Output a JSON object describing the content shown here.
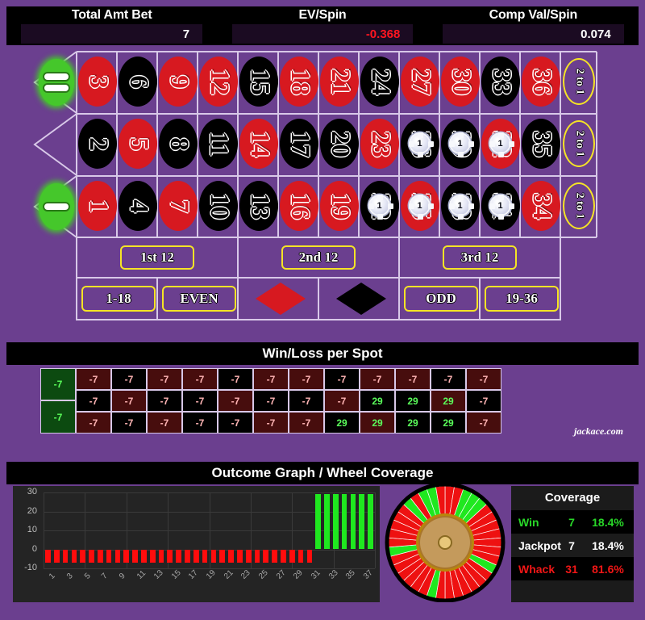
{
  "stats": {
    "items": [
      {
        "label": "Total Amt Bet",
        "value": "7",
        "negative": false
      },
      {
        "label": "EV/Spin",
        "value": "-0.368",
        "negative": true
      },
      {
        "label": "Comp Val/Spin",
        "value": "0.074",
        "negative": false
      }
    ]
  },
  "table": {
    "zeros": [
      {
        "name": "00",
        "pips": 2
      },
      {
        "name": "0",
        "pips": 1
      }
    ],
    "rows": [
      {
        "numbers": [
          {
            "n": "3",
            "color": "red"
          },
          {
            "n": "6",
            "color": "black"
          },
          {
            "n": "9",
            "color": "red"
          },
          {
            "n": "12",
            "color": "red"
          },
          {
            "n": "15",
            "color": "black"
          },
          {
            "n": "18",
            "color": "red"
          },
          {
            "n": "21",
            "color": "red"
          },
          {
            "n": "24",
            "color": "black"
          },
          {
            "n": "27",
            "color": "red"
          },
          {
            "n": "30",
            "color": "red"
          },
          {
            "n": "33",
            "color": "black"
          },
          {
            "n": "36",
            "color": "red"
          }
        ]
      },
      {
        "numbers": [
          {
            "n": "2",
            "color": "black"
          },
          {
            "n": "5",
            "color": "red"
          },
          {
            "n": "8",
            "color": "black"
          },
          {
            "n": "11",
            "color": "black"
          },
          {
            "n": "14",
            "color": "red"
          },
          {
            "n": "17",
            "color": "black"
          },
          {
            "n": "20",
            "color": "black"
          },
          {
            "n": "23",
            "color": "red"
          },
          {
            "n": "26",
            "color": "black",
            "chip": "1"
          },
          {
            "n": "29",
            "color": "black",
            "chip": "1"
          },
          {
            "n": "32",
            "color": "red",
            "chip": "1"
          },
          {
            "n": "35",
            "color": "black"
          }
        ]
      },
      {
        "numbers": [
          {
            "n": "1",
            "color": "red"
          },
          {
            "n": "4",
            "color": "black"
          },
          {
            "n": "7",
            "color": "red"
          },
          {
            "n": "10",
            "color": "black"
          },
          {
            "n": "13",
            "color": "black"
          },
          {
            "n": "16",
            "color": "red"
          },
          {
            "n": "19",
            "color": "red"
          },
          {
            "n": "22",
            "color": "black",
            "chip": "1"
          },
          {
            "n": "25",
            "color": "red",
            "chip": "1"
          },
          {
            "n": "28",
            "color": "black",
            "chip": "1"
          },
          {
            "n": "31",
            "color": "black",
            "chip": "1"
          },
          {
            "n": "34",
            "color": "red"
          }
        ]
      }
    ],
    "column_bets": [
      "2 to 1",
      "2 to 1",
      "2 to 1"
    ],
    "dozens": [
      "1st 12",
      "2nd 12",
      "3rd 12"
    ],
    "outside": [
      {
        "label": "1-18",
        "kind": "text"
      },
      {
        "label": "EVEN",
        "kind": "text"
      },
      {
        "label": "RED",
        "kind": "diamond-red"
      },
      {
        "label": "BLACK",
        "kind": "diamond-black"
      },
      {
        "label": "ODD",
        "kind": "text"
      },
      {
        "label": "19-36",
        "kind": "text"
      }
    ]
  },
  "winloss": {
    "title": "Win/Loss per Spot",
    "zero_cells": [
      {
        "label": "-7",
        "name": "00"
      },
      {
        "label": "-7",
        "name": "0"
      }
    ],
    "rows": [
      {
        "cells": [
          {
            "v": "-7",
            "color": "red",
            "res": "lose"
          },
          {
            "v": "-7",
            "color": "black",
            "res": "lose"
          },
          {
            "v": "-7",
            "color": "red",
            "res": "lose"
          },
          {
            "v": "-7",
            "color": "red",
            "res": "lose"
          },
          {
            "v": "-7",
            "color": "black",
            "res": "lose"
          },
          {
            "v": "-7",
            "color": "red",
            "res": "lose"
          },
          {
            "v": "-7",
            "color": "red",
            "res": "lose"
          },
          {
            "v": "-7",
            "color": "black",
            "res": "lose"
          },
          {
            "v": "-7",
            "color": "red",
            "res": "lose"
          },
          {
            "v": "-7",
            "color": "red",
            "res": "lose"
          },
          {
            "v": "-7",
            "color": "black",
            "res": "lose"
          },
          {
            "v": "-7",
            "color": "red",
            "res": "lose"
          }
        ]
      },
      {
        "cells": [
          {
            "v": "-7",
            "color": "black",
            "res": "lose"
          },
          {
            "v": "-7",
            "color": "red",
            "res": "lose"
          },
          {
            "v": "-7",
            "color": "black",
            "res": "lose"
          },
          {
            "v": "-7",
            "color": "black",
            "res": "lose"
          },
          {
            "v": "-7",
            "color": "red",
            "res": "lose"
          },
          {
            "v": "-7",
            "color": "black",
            "res": "lose"
          },
          {
            "v": "-7",
            "color": "black",
            "res": "lose"
          },
          {
            "v": "-7",
            "color": "red",
            "res": "lose"
          },
          {
            "v": "29",
            "color": "black",
            "res": "win"
          },
          {
            "v": "29",
            "color": "black",
            "res": "win"
          },
          {
            "v": "29",
            "color": "red",
            "res": "win"
          },
          {
            "v": "-7",
            "color": "black",
            "res": "lose"
          }
        ]
      },
      {
        "cells": [
          {
            "v": "-7",
            "color": "red",
            "res": "lose"
          },
          {
            "v": "-7",
            "color": "black",
            "res": "lose"
          },
          {
            "v": "-7",
            "color": "red",
            "res": "lose"
          },
          {
            "v": "-7",
            "color": "black",
            "res": "lose"
          },
          {
            "v": "-7",
            "color": "black",
            "res": "lose"
          },
          {
            "v": "-7",
            "color": "red",
            "res": "lose"
          },
          {
            "v": "-7",
            "color": "red",
            "res": "lose"
          },
          {
            "v": "29",
            "color": "black",
            "res": "win"
          },
          {
            "v": "29",
            "color": "red",
            "res": "win"
          },
          {
            "v": "29",
            "color": "black",
            "res": "win"
          },
          {
            "v": "29",
            "color": "black",
            "res": "win"
          },
          {
            "v": "-7",
            "color": "red",
            "res": "lose"
          }
        ]
      }
    ],
    "watermark": "jackace.com"
  },
  "graph_section": {
    "title": "Outcome Graph / Wheel Coverage"
  },
  "chart_data": {
    "type": "bar",
    "title": "Outcome Graph / Wheel Coverage",
    "xlabel": "",
    "ylabel": "",
    "ylim": [
      -10,
      30
    ],
    "yticks": [
      30,
      20,
      10,
      0,
      -10
    ],
    "grid": true,
    "xticks": [
      "1",
      "3",
      "5",
      "7",
      "9",
      "11",
      "13",
      "15",
      "17",
      "19",
      "21",
      "23",
      "25",
      "27",
      "29",
      "31",
      "33",
      "35",
      "37"
    ],
    "x": [
      1,
      2,
      3,
      4,
      5,
      6,
      7,
      8,
      9,
      10,
      11,
      12,
      13,
      14,
      15,
      16,
      17,
      18,
      19,
      20,
      21,
      22,
      23,
      24,
      25,
      26,
      27,
      28,
      29,
      30,
      31,
      32,
      33,
      34,
      35,
      36,
      37,
      38
    ],
    "values": [
      -7,
      -7,
      -7,
      -7,
      -7,
      -7,
      -7,
      -7,
      -7,
      -7,
      -7,
      -7,
      -7,
      -7,
      -7,
      -7,
      -7,
      -7,
      -7,
      -7,
      -7,
      -7,
      -7,
      -7,
      -7,
      -7,
      -7,
      -7,
      -7,
      -7,
      -7,
      29,
      29,
      29,
      29,
      29,
      29,
      29
    ],
    "colors": {
      "negative": "#ff0d0d",
      "positive": "#1fe81f"
    }
  },
  "coverage": {
    "title": "Coverage",
    "rows": [
      {
        "name": "Win",
        "count": "7",
        "pct": "18.4%",
        "style": "win"
      },
      {
        "name": "Jackpot",
        "count": "7",
        "pct": "18.4%",
        "style": "jack"
      },
      {
        "name": "Whack",
        "count": "31",
        "pct": "81.6%",
        "style": "whack"
      }
    ]
  },
  "wheel": {
    "win_segments": 7,
    "total_segments": 38
  }
}
